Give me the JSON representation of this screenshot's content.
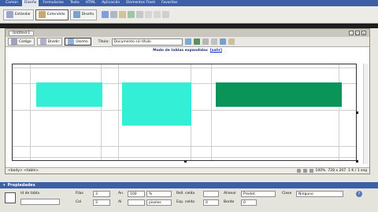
{
  "insertbar": {
    "tabs": [
      "Común",
      "Diseño",
      "Formularios",
      "Texto",
      "HTML",
      "Aplicación",
      "Elementos Flash",
      "Favoritos"
    ],
    "active_index": 1
  },
  "toolbar": {
    "buttons": [
      {
        "label": "Estándar",
        "icon": "table-standard-icon",
        "color": "#9aa7c7"
      },
      {
        "label": "Extendido",
        "icon": "table-expanded-icon",
        "color": "#c9a86a"
      },
      {
        "label": "Diseño",
        "icon": "layout-mode-icon",
        "color": "#7f9fcf"
      }
    ],
    "active_index": 1
  },
  "document": {
    "tab_name": "Untitled-1",
    "views": {
      "code": "Código",
      "split": "Dividir",
      "design": "Diseño"
    },
    "title_label": "Título:",
    "title_value": "Documento sin título",
    "hint_text": "Modo de tablas expandidas",
    "hint_link": "[salir]",
    "status_tag": "<body> <table>",
    "status_zoom": "100%",
    "status_size": "728 x 207",
    "status_weight": "1 K / 1 seg"
  },
  "colors": {
    "block_cyan": "#33efd6",
    "block_green": "#0a9457",
    "panel_bar": "#3d5fa8"
  },
  "properties": {
    "title": "Propiedades",
    "table_name_label": "Id de tabla",
    "rows_label": "Filas",
    "rows_value": "3",
    "cols_label": "Col",
    "cols_value": "3",
    "width_label": "An",
    "width_value": "100",
    "width_unit": "%",
    "height_label": "Al",
    "height_unit": "píxeles",
    "cellpad_label": "Rell. celda",
    "cellspace_label": "Esp. celda",
    "cellspace_value": "0",
    "align_label": "Alinear",
    "align_value": "Predet.",
    "border_label": "Borde",
    "border_value": "0",
    "class_label": "Clase",
    "class_value": "Ninguno"
  }
}
